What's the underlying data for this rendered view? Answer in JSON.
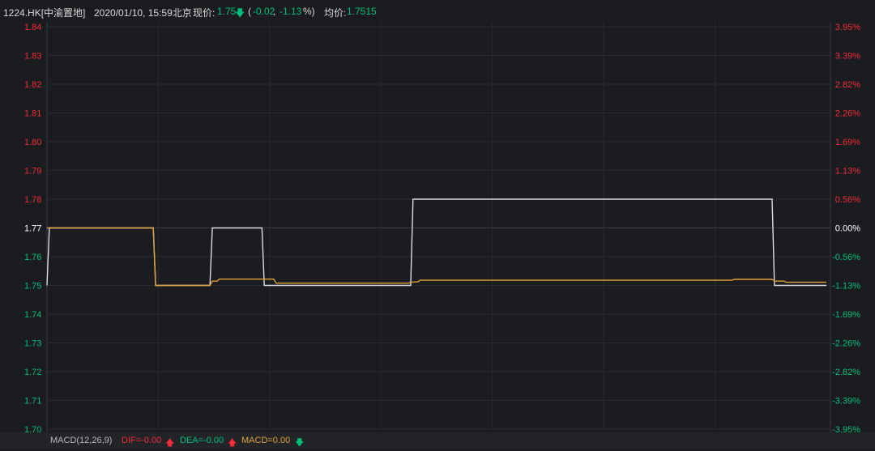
{
  "header": {
    "symbol": "1224.HK[中渝置地]",
    "datetime": "2020/01/10, 15:59北京",
    "price_label": "现价:",
    "price": "1.75",
    "change_open": "(",
    "change": "-0.02",
    "sep": ", ",
    "change_pct": "-1.13",
    "change_close": "%)",
    "avg_label": "均价:",
    "avg": "1.7515"
  },
  "footer": {
    "macd_label": "MACD(12,26,9)",
    "dif": "DIF=-0.00",
    "dea": "DEA=-0.00",
    "macd": "MACD=0.00"
  },
  "colors": {
    "price_line": "#d9dce3",
    "avg_line": "#e0a03a",
    "up": "#f22b3b",
    "down": "#00c07a",
    "neutral": "#ffffff"
  },
  "chart_data": {
    "type": "line",
    "y_left_ticks": [
      "1.84",
      "1.83",
      "1.82",
      "1.81",
      "1.80",
      "1.79",
      "1.78",
      "1.77",
      "1.76",
      "1.75",
      "1.74",
      "1.73",
      "1.72",
      "1.71",
      "1.70"
    ],
    "y_right_ticks": [
      "3.95%",
      "3.39%",
      "2.82%",
      "2.26%",
      "1.69%",
      "1.13%",
      "0.56%",
      "0.00%",
      "-0.56%",
      "-1.13%",
      "-1.69%",
      "-2.26%",
      "-2.82%",
      "-3.39%",
      "-3.95%"
    ],
    "ylim": [
      1.7,
      1.84
    ],
    "xlim": [
      0,
      330
    ],
    "prev_close": 1.77,
    "series": [
      {
        "x": [
          0,
          1,
          45,
          46,
          69,
          70,
          91,
          92,
          154,
          155,
          307,
          308,
          330
        ],
        "y": [
          1.75,
          1.77,
          1.77,
          1.75,
          1.75,
          1.77,
          1.77,
          1.75,
          1.75,
          1.78,
          1.78,
          1.75,
          1.75
        ]
      },
      {
        "x": [
          0,
          1,
          45,
          46,
          69,
          70,
          72,
          73,
          96,
          97,
          153,
          155,
          157,
          158,
          290,
          291,
          307,
          308,
          312,
          313,
          330
        ],
        "y": [
          1.77,
          1.77,
          1.77,
          1.75,
          1.75,
          1.7515,
          1.7515,
          1.7522,
          1.7522,
          1.7508,
          1.7508,
          1.7512,
          1.7512,
          1.7518,
          1.7518,
          1.7521,
          1.7521,
          1.7515,
          1.7515,
          1.7511,
          1.7511
        ]
      }
    ]
  }
}
